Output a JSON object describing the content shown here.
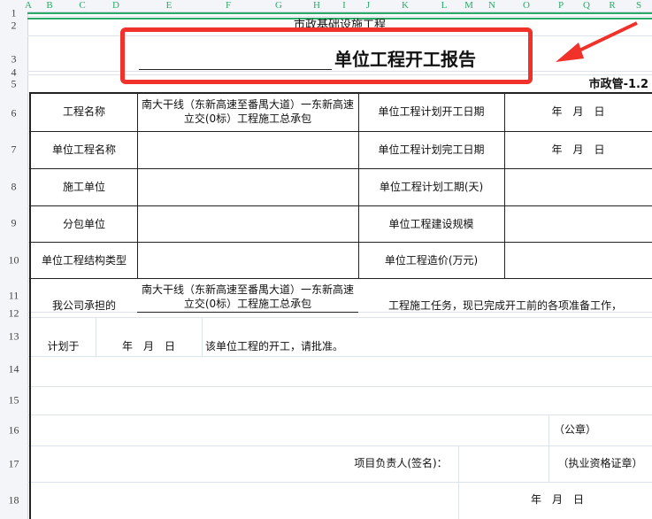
{
  "columns": [
    "A",
    "B",
    "C",
    "D",
    "E",
    "F",
    "G",
    "H",
    "I",
    "J",
    "K",
    "L",
    "M",
    "N",
    "O",
    "P",
    "Q",
    "R",
    "S"
  ],
  "rows": [
    "1",
    "2",
    "3",
    "4",
    "5",
    "6",
    "7",
    "8",
    "9",
    "10",
    "11",
    "12",
    "13",
    "14",
    "15",
    "16",
    "17",
    "18"
  ],
  "header": {
    "org": "市政基础设施工程",
    "title": "单位工程开工报告",
    "form_code": "市政管-1.2"
  },
  "table": {
    "project_name_label": "工程名称",
    "project_name_value": "南大干线（东新高速至番禺大道）一东新高速立交(0标）工程施工总承包",
    "planned_start_label": "单位工程计划开工日期",
    "planned_start_value": "年　月　日",
    "unit_name_label": "单位工程名称",
    "planned_finish_label": "单位工程计划完工日期",
    "planned_finish_value": "年　月　日",
    "contractor_label": "施工单位",
    "planned_duration_label": "单位工程计划工期(天)",
    "subcontractor_label": "分包单位",
    "scale_label": "单位工程建设规模",
    "structure_label": "单位工程结构类型",
    "cost_label": "单位工程造价(万元)",
    "statement_prefix": "我公司承担的",
    "statement_project": "南大干线（东新高速至番禺大道）一东新高速立交(0标）工程施工总承包",
    "statement_suffix": "工程施工任务，现已完成开工前的各项准备工作，",
    "plan_label": "计划于",
    "plan_date": "年　月　日",
    "plan_suffix": "该单位工程的开工，请批准。",
    "seal": "（公章）",
    "manager_label": "项目负责人(签名)：",
    "cert_seal": "（执业资格证章）",
    "sign_date": "年　月　日"
  }
}
